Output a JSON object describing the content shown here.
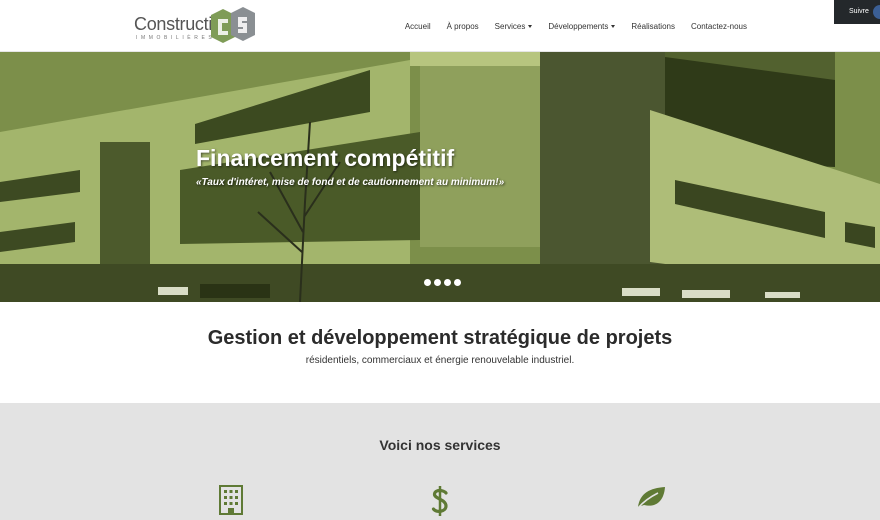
{
  "brand": {
    "name": "Construction",
    "tagline": "IMMOBILIÈRES",
    "logo_colors": {
      "green": "#7f9c57",
      "gray": "#8a8f93"
    }
  },
  "nav": {
    "items": [
      {
        "label": "Accueil"
      },
      {
        "label": "À propos"
      },
      {
        "label": "Services",
        "dropdown": true
      },
      {
        "label": "Développements",
        "dropdown": true
      },
      {
        "label": "Réalisations"
      },
      {
        "label": "Contactez-nous"
      }
    ]
  },
  "follow": {
    "label": "Suivre"
  },
  "hero": {
    "title": "Financement compétitif",
    "caption": "«Taux d'intéret, mise de fond et de cautionnement au minimum!»",
    "tint": "#6b7f3a",
    "slide_count": 4,
    "active_slide": 1
  },
  "intro": {
    "title": "Gestion et développement stratégique de projets",
    "subtitle": "résidentiels, commerciaux et énergie renouvelable industriel."
  },
  "services": {
    "title": "Voici nos services",
    "icons": [
      "building-icon",
      "dollar-icon",
      "leaf-icon"
    ],
    "icon_color": "#5f7a35"
  }
}
